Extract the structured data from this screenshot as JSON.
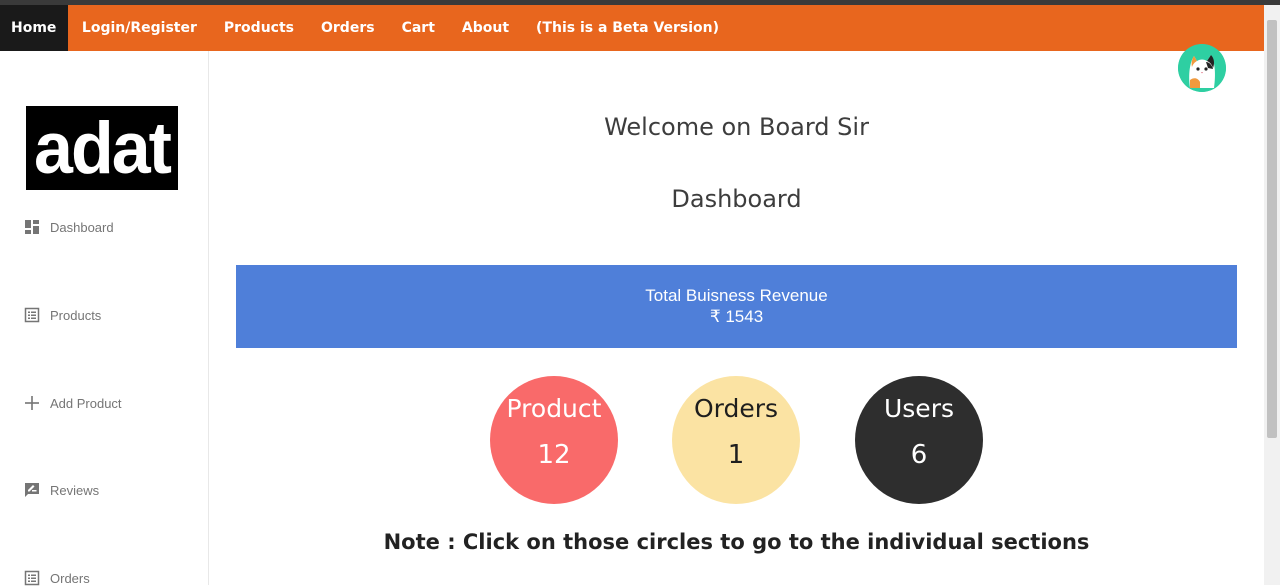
{
  "navbar": {
    "items": [
      {
        "label": "Home",
        "active": true
      },
      {
        "label": "Login/Register"
      },
      {
        "label": "Products"
      },
      {
        "label": "Orders"
      },
      {
        "label": "Cart"
      },
      {
        "label": "About"
      },
      {
        "label": "(This is a Beta Version)"
      }
    ]
  },
  "sidebar": {
    "logo_text": "adat",
    "items": [
      {
        "label": "Dashboard",
        "icon": "dashboard-icon"
      },
      {
        "label": "Products",
        "icon": "list-icon"
      },
      {
        "label": "Add Product",
        "icon": "plus-icon"
      },
      {
        "label": "Reviews",
        "icon": "rate-review-icon"
      },
      {
        "label": "Orders",
        "icon": "list-icon"
      }
    ]
  },
  "main": {
    "welcome": "Welcome on Board Sir",
    "heading": "Dashboard",
    "revenue": {
      "label": "Total Buisness Revenue",
      "value": "₹ 1543"
    },
    "stats": [
      {
        "label": "Product",
        "value": "12",
        "color": "#f96a6a",
        "text_color": "#ffffff"
      },
      {
        "label": "Orders",
        "value": "1",
        "color": "#fbe3a3",
        "text_color": "#1e1e1e"
      },
      {
        "label": "Users",
        "value": "6",
        "color": "#2e2e2e",
        "text_color": "#ffffff"
      }
    ],
    "note": "Note : Click on those circles to go to the individual sections"
  },
  "colors": {
    "navbar": "#e8661e",
    "revenue_bar": "#4f7fd9"
  }
}
